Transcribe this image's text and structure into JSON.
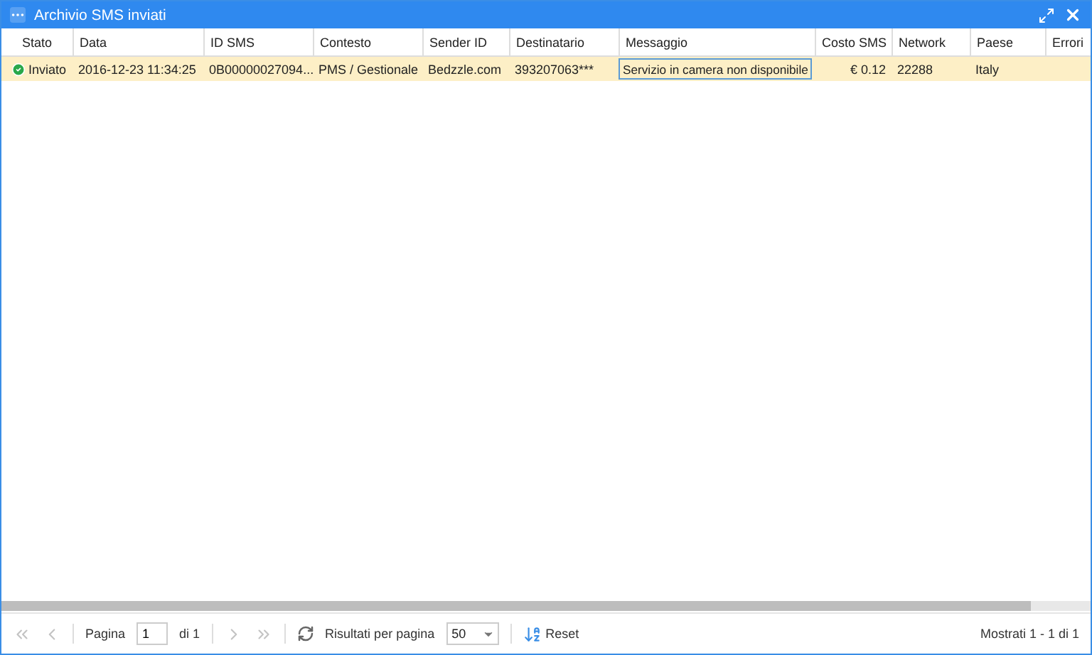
{
  "window": {
    "title": "Archivio SMS inviati"
  },
  "table": {
    "columns": [
      "Stato",
      "Data",
      "ID SMS",
      "Contesto",
      "Sender ID",
      "Destinatario",
      "Messaggio",
      "Costo SMS",
      "Network",
      "Paese",
      "Errori"
    ],
    "rows": [
      {
        "selected": true,
        "cells": [
          {
            "text": "Inviato",
            "focused": false,
            "kind": "status"
          },
          {
            "text": "2016-12-23 11:34:25",
            "focused": false
          },
          {
            "text": "0B00000027094...",
            "focused": false
          },
          {
            "text": "PMS / Gestionale",
            "focused": false
          },
          {
            "text": "Bedzzle.com",
            "focused": false
          },
          {
            "text": "393207063***",
            "focused": false
          },
          {
            "text": "Servizio in camera non disponibile",
            "focused": true
          },
          {
            "text": "€ 0.12",
            "focused": false,
            "kind": "amount"
          },
          {
            "text": "22288",
            "focused": false
          },
          {
            "text": "Italy",
            "focused": false
          }
        ]
      }
    ]
  },
  "pager": {
    "first_disabled": true,
    "prev_disabled": true,
    "next_disabled": true,
    "last_disabled": true,
    "page_label": "Pagina",
    "page": "1",
    "of": "di 1",
    "per_page_label": "Risultati per pagina",
    "per_page": "50",
    "reset": "Reset",
    "summary": "Mostrati 1 - 1 di 1"
  }
}
